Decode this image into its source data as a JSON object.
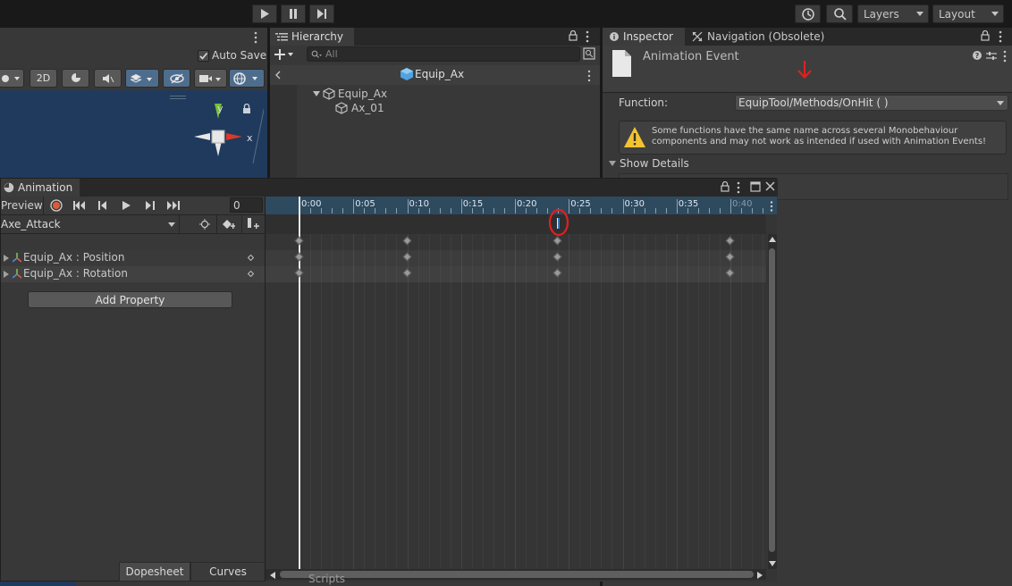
{
  "toolbar": {
    "layers": "Layers",
    "layout": "Layout"
  },
  "scene": {
    "auto_save": "Auto Save",
    "mode_2d": "2D",
    "gizmo_y": "y",
    "gizmo_x": "x"
  },
  "hierarchy": {
    "tab": "Hierarchy",
    "search_placeholder": "All",
    "scene_name": "Equip_Ax",
    "items": [
      {
        "label": "Equip_Ax"
      },
      {
        "label": "Ax_01"
      }
    ]
  },
  "inspector": {
    "tab_inspector": "Inspector",
    "tab_navigation": "Navigation (Obsolete)",
    "title": "Animation Event",
    "function_label": "Function:",
    "function_value": "EquipTool/Methods/OnHit ( )",
    "warning": "Some functions have the same name across several Monobehaviour components and may not work as intended if used with Animation Events!",
    "show_details": "Show Details"
  },
  "animation": {
    "tab": "Animation",
    "preview": "Preview",
    "frame": "0",
    "clip": "Axe_Attack",
    "properties": [
      {
        "label": "Equip_Ax : Position"
      },
      {
        "label": "Equip_Ax : Rotation"
      }
    ],
    "add_property": "Add Property",
    "dopesheet": "Dopesheet",
    "curves": "Curves",
    "timeline_labels": [
      "0:00",
      "0:05",
      "0:10",
      "0:15",
      "0:20",
      "0:25",
      "0:30",
      "0:35",
      "0:40"
    ],
    "keyframe_frames": [
      0,
      10,
      24,
      40
    ],
    "event_frame": 24
  },
  "project": {
    "scripts": "Scripts"
  },
  "colors": {
    "accent": "#3a79bb",
    "annotation": "#e02020",
    "record": "#e05a3a",
    "warning": "#f4c430"
  }
}
